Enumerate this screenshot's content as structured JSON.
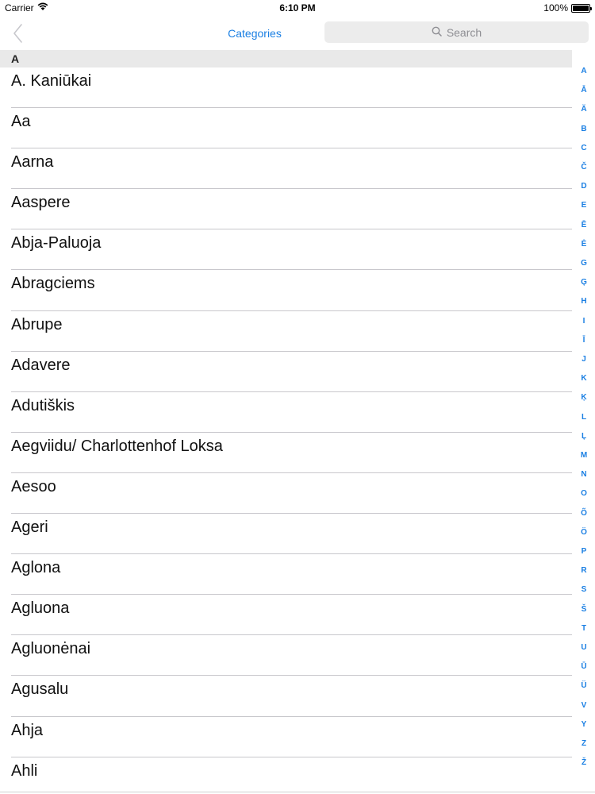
{
  "status_bar": {
    "carrier": "Carrier",
    "time": "6:10 PM",
    "battery": "100%"
  },
  "nav_bar": {
    "title": "Categories",
    "search_placeholder": "Search"
  },
  "section": {
    "header": "A",
    "items": [
      "A. Kaniūkai",
      "Aa",
      "Aarna",
      "Aaspere",
      "Abja-Paluoja",
      "Abragciems",
      "Abrupe",
      "Adavere",
      "Adutiškis",
      "Aegviidu/ Charlottenhof Loksa",
      "Aesoo",
      "Ageri",
      "Aglona",
      "Agluona",
      "Agluonėnai",
      "Agusalu",
      "Ahja",
      "Ahli"
    ]
  },
  "index": [
    "A",
    "Ā",
    "Ä",
    "B",
    "C",
    "Č",
    "D",
    "E",
    "Ē",
    "Ė",
    "G",
    "Ģ",
    "H",
    "I",
    "Ī",
    "J",
    "K",
    "Ķ",
    "L",
    "Ļ",
    "M",
    "N",
    "O",
    "Õ",
    "Ö",
    "P",
    "R",
    "S",
    "Š",
    "T",
    "U",
    "Ū",
    "Ü",
    "V",
    "Y",
    "Z",
    "Ž"
  ],
  "colors": {
    "accent": "#1a7fe3",
    "section_bg": "#e9e9e9",
    "separator": "#c8c7cc",
    "search_bg": "#ececec"
  }
}
